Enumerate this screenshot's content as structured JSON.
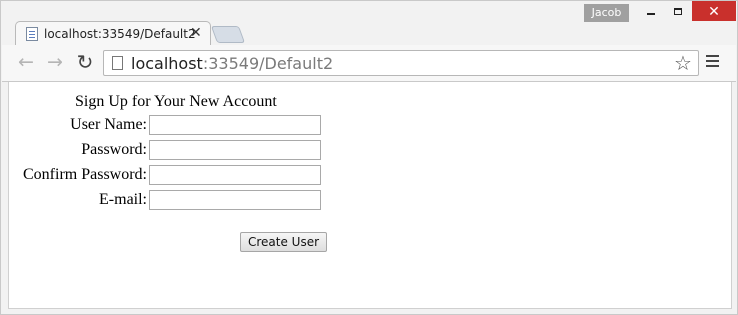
{
  "window": {
    "user_name": "Jacob",
    "controls": {
      "close_symbol": "✕"
    }
  },
  "tab": {
    "title": "localhost:33549/Default2",
    "close_symbol": "✕"
  },
  "toolbar": {
    "back_symbol": "←",
    "forward_symbol": "→",
    "reload_symbol": "↻",
    "url_host": "localhost",
    "url_rest": ":33549/Default2",
    "star_symbol": "☆"
  },
  "form": {
    "title": "Sign Up for Your New Account",
    "fields": [
      {
        "label": "User Name:",
        "value": ""
      },
      {
        "label": "Password:",
        "value": ""
      },
      {
        "label": "Confirm Password:",
        "value": ""
      },
      {
        "label": "E-mail:",
        "value": ""
      }
    ],
    "submit_label": "Create User"
  },
  "colors": {
    "close_button": "#c9302c",
    "user_badge": "#a0a0a0"
  }
}
